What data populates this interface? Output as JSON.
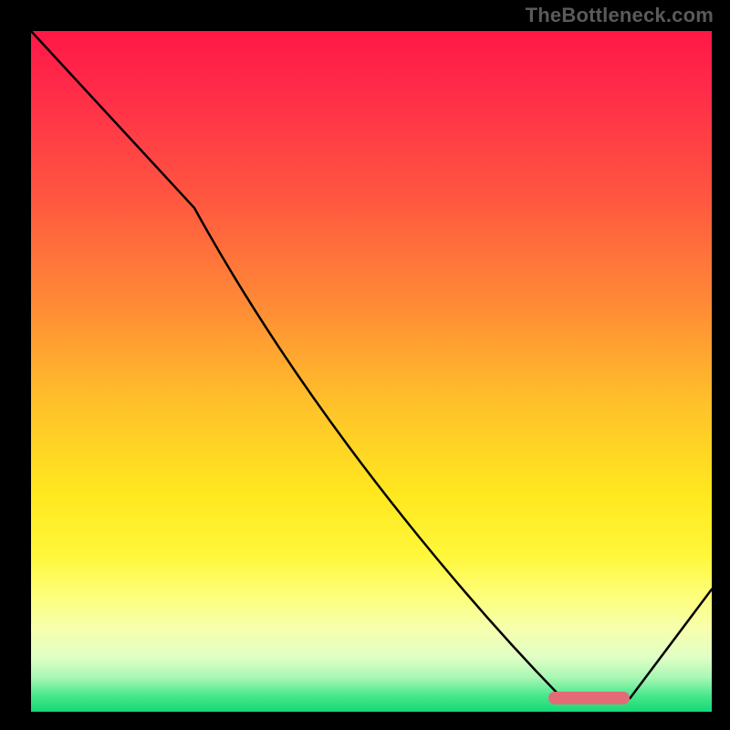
{
  "attribution": "TheBottleneck.com",
  "chart_data": {
    "type": "line",
    "title": "",
    "xlabel": "",
    "ylabel": "",
    "xlim": [
      0,
      100
    ],
    "ylim": [
      0,
      100
    ],
    "x": [
      0,
      24,
      78,
      88,
      100
    ],
    "values": [
      100,
      74,
      2,
      2,
      18
    ],
    "gradient_stops": [
      {
        "pos": 0.0,
        "color": "#ff1846"
      },
      {
        "pos": 0.08,
        "color": "#ff2a49"
      },
      {
        "pos": 0.24,
        "color": "#ff5540"
      },
      {
        "pos": 0.4,
        "color": "#ff8a36"
      },
      {
        "pos": 0.55,
        "color": "#ffc22a"
      },
      {
        "pos": 0.68,
        "color": "#ffe81f"
      },
      {
        "pos": 0.77,
        "color": "#fff73a"
      },
      {
        "pos": 0.83,
        "color": "#fdff7a"
      },
      {
        "pos": 0.88,
        "color": "#f6ffb0"
      },
      {
        "pos": 0.92,
        "color": "#e0ffc4"
      },
      {
        "pos": 0.95,
        "color": "#a7f7b4"
      },
      {
        "pos": 0.975,
        "color": "#4de88e"
      },
      {
        "pos": 1.0,
        "color": "#14d976"
      }
    ],
    "marker": {
      "x_start": 76,
      "x_end": 88,
      "y": 2,
      "color": "#e26b76"
    }
  }
}
